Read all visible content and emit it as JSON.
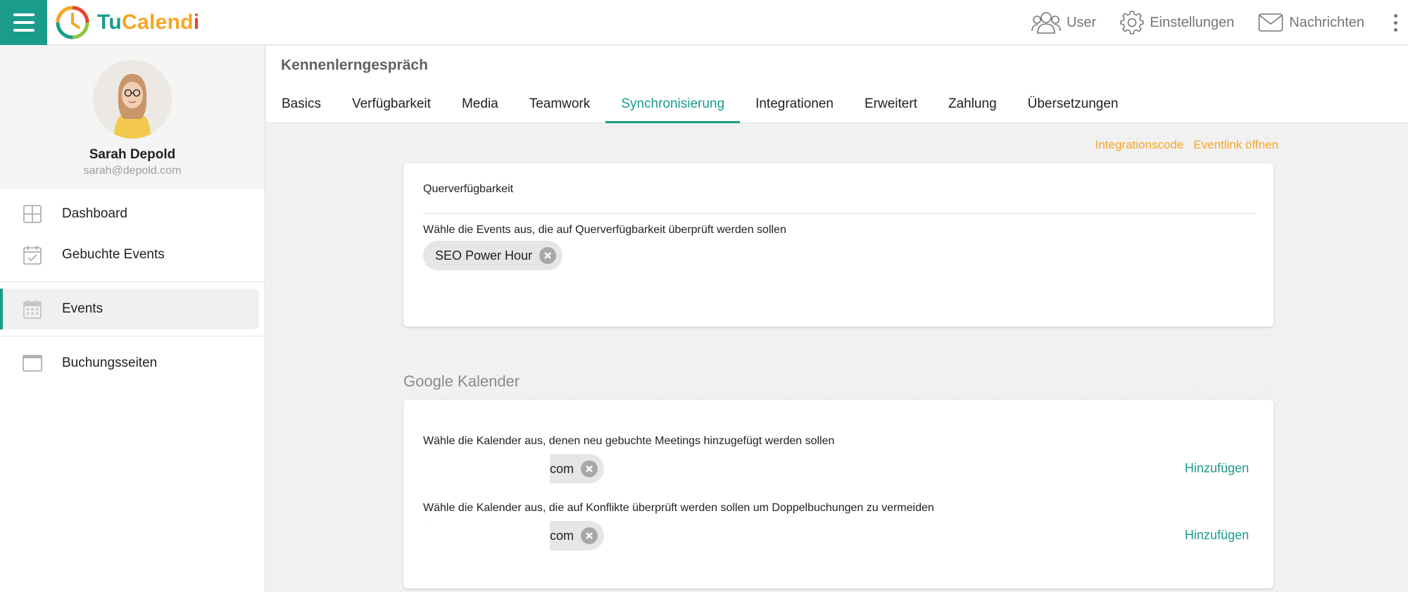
{
  "app": {
    "name_part1": "Tu",
    "name_part2": "Calend",
    "name_part3": "i",
    "brand_color": "#1a9c8c",
    "accent_color": "#f5a623"
  },
  "topbar": {
    "user_label": "User",
    "settings_label": "Einstellungen",
    "messages_label": "Nachrichten"
  },
  "profile": {
    "name": "Sarah Depold",
    "email": "sarah@depold.com"
  },
  "sidebar": {
    "items": [
      {
        "label": "Dashboard",
        "icon": "dashboard-icon"
      },
      {
        "label": "Gebuchte Events",
        "icon": "calendar-check-icon"
      },
      {
        "label": "Events",
        "icon": "calendar-grid-icon",
        "active": true
      },
      {
        "label": "Buchungsseiten",
        "icon": "browser-window-icon"
      }
    ]
  },
  "page": {
    "title": "Kennenlerngespräch",
    "tabs": [
      {
        "label": "Basics"
      },
      {
        "label": "Verfügbarkeit"
      },
      {
        "label": "Media"
      },
      {
        "label": "Teamwork"
      },
      {
        "label": "Synchronisierung",
        "active": true
      },
      {
        "label": "Integrationen"
      },
      {
        "label": "Erweitert"
      },
      {
        "label": "Zahlung"
      },
      {
        "label": "Übersetzungen"
      }
    ],
    "links": {
      "integration_code": "Integrationscode",
      "open_event_link": "Eventlink öffnen"
    }
  },
  "cross_availability": {
    "title": "Querverfügbarkeit",
    "label": "Wähle die Events aus, die auf Querverfügbarkeit überprüft werden sollen",
    "chips": [
      "SEO Power Hour"
    ]
  },
  "google_calendar": {
    "section_title": "Google Kalender",
    "add_calendar_label": "Wähle die Kalender aus, denen neu gebuchte Meetings hinzugefügt werden sollen",
    "add_calendar_chip": "com",
    "add_calendar_action": "Hinzufügen",
    "conflict_label": "Wähle die Kalender aus, die auf Konflikte überprüft werden sollen um Doppelbuchungen zu vermeiden",
    "conflict_chip": "com",
    "conflict_action": "Hinzufügen"
  }
}
